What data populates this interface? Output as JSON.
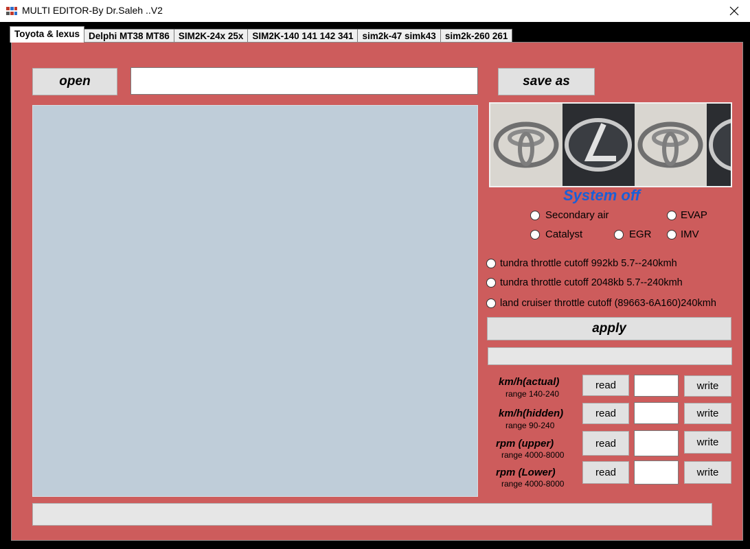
{
  "window": {
    "title": "MULTI EDITOR-By Dr.Saleh ..V2",
    "close_icon": "close-icon"
  },
  "tabs": [
    {
      "label": "Toyota & lexus",
      "active": true
    },
    {
      "label": "Delphi MT38 MT86",
      "active": false
    },
    {
      "label": "SIM2K-24x 25x",
      "active": false
    },
    {
      "label": "SIM2K-140 141 142 341",
      "active": false
    },
    {
      "label": "sim2k-47 simk43",
      "active": false
    },
    {
      "label": "sim2k-260 261",
      "active": false
    }
  ],
  "file": {
    "open_label": "open",
    "path_value": "",
    "save_as_label": "save as"
  },
  "status": {
    "system_text": "System off"
  },
  "systems": {
    "secondary_air": "Secondary air",
    "evap": "EVAP",
    "catalyst": "Catalyst",
    "egr": "EGR",
    "imv": "IMV"
  },
  "throttle": {
    "opt1": "tundra throttle cutoff 992kb 5.7--240kmh",
    "opt2": "tundra throttle cutoff 2048kb 5.7--240kmh",
    "opt3": "land cruiser throttle cutoff (89663-6A160)240kmh"
  },
  "apply_label": "apply",
  "params": [
    {
      "name": "km/h(actual)",
      "range": "range 140-240",
      "read": "read",
      "write": "write",
      "value": ""
    },
    {
      "name": "km/h(hidden)",
      "range": "range 90-240",
      "read": "read",
      "write": "write",
      "value": ""
    },
    {
      "name": "rpm (upper)",
      "range": "range 4000-8000",
      "read": "read",
      "write": "write",
      "value": ""
    },
    {
      "name": "rpm (Lower)",
      "range": "range 4000-8000",
      "read": "read",
      "write": "write",
      "value": ""
    }
  ],
  "colors": {
    "panel": "#cd5c5c",
    "status_blue": "#1a5fd6",
    "editor_bg": "#bfcdd9"
  }
}
